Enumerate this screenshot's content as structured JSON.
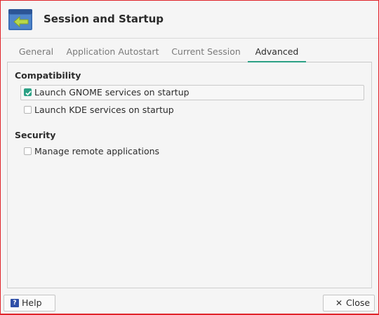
{
  "window": {
    "title": "Session and Startup",
    "app_icon": "session-startup-icon"
  },
  "tabs": [
    {
      "label": "General",
      "active": false
    },
    {
      "label": "Application Autostart",
      "active": false
    },
    {
      "label": "Current Session",
      "active": false
    },
    {
      "label": "Advanced",
      "active": true
    }
  ],
  "sections": {
    "compatibility": {
      "title": "Compatibility",
      "options": [
        {
          "label": "Launch GNOME services on startup",
          "checked": true
        },
        {
          "label": "Launch KDE services on startup",
          "checked": false
        }
      ]
    },
    "security": {
      "title": "Security",
      "options": [
        {
          "label": "Manage remote applications",
          "checked": false
        }
      ]
    }
  },
  "footer": {
    "help_label": "Help",
    "help_icon": "help-icon",
    "close_label": "Close",
    "close_icon": "close-icon"
  },
  "colors": {
    "accent": "#2ca185",
    "window_border": "#e0242a"
  }
}
